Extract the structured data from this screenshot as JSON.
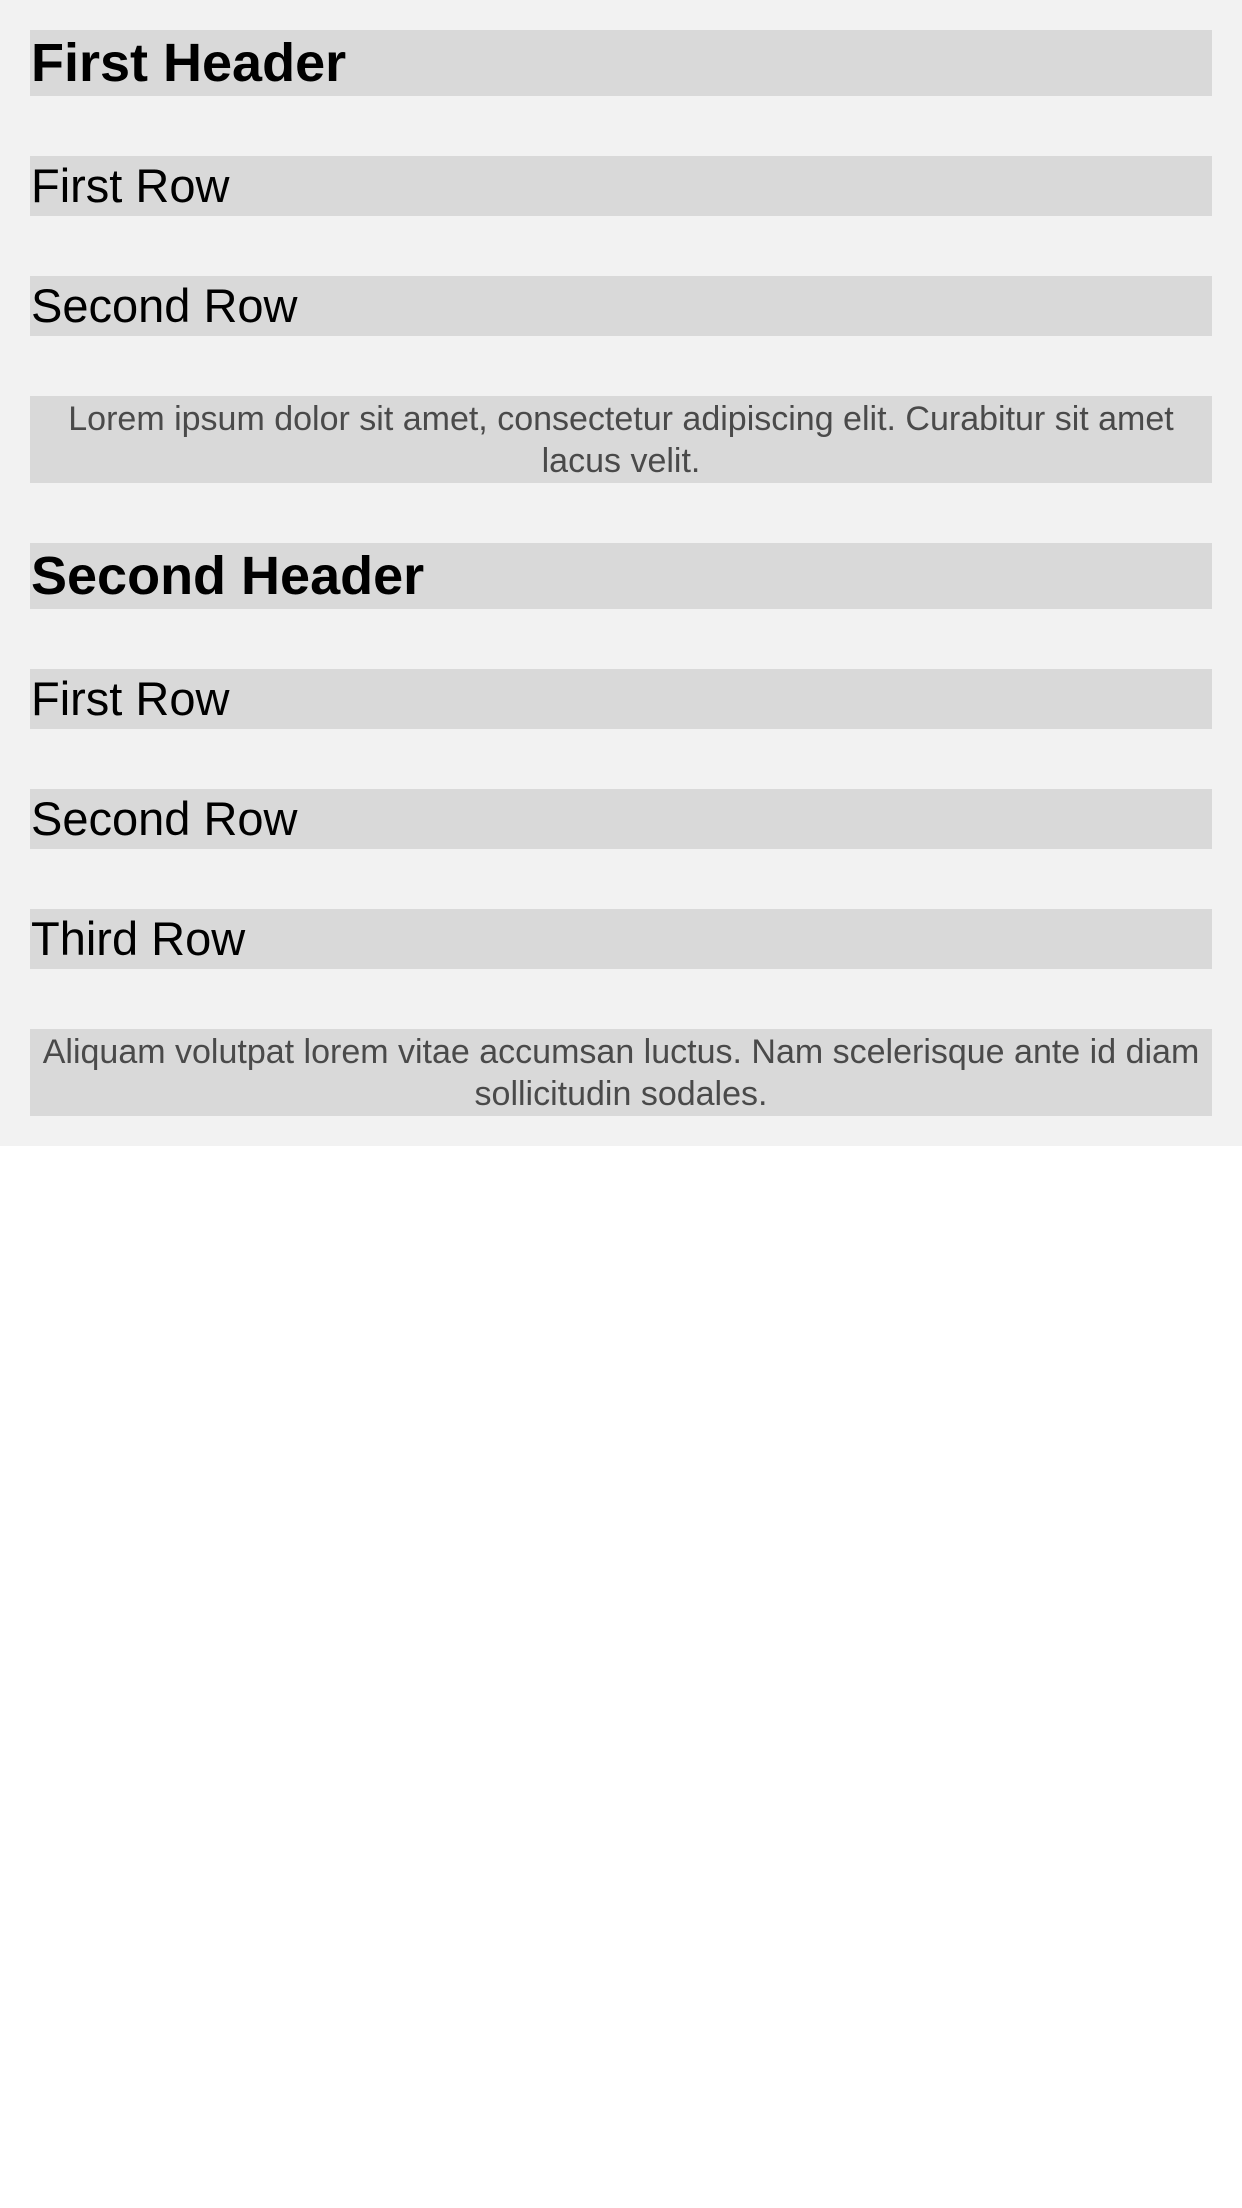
{
  "sections": [
    {
      "header": "First Header",
      "rows": [
        "First Row",
        "Second Row"
      ],
      "footer": "Lorem ipsum dolor sit amet, consectetur adipiscing elit. Curabitur sit amet lacus velit."
    },
    {
      "header": "Second Header",
      "rows": [
        "First Row",
        "Second Row",
        "Third Row"
      ],
      "footer": "Aliquam volutpat lorem vitae accumsan luctus. Nam scelerisque ante id diam sollicitudin sodales."
    }
  ]
}
